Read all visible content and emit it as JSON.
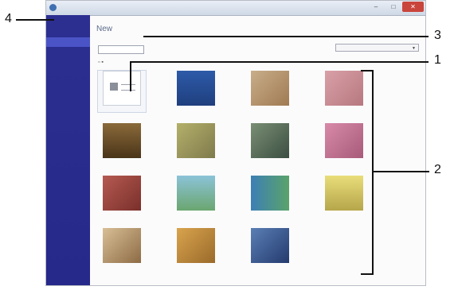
{
  "window": {
    "title": "",
    "controls": {
      "minimize": "–",
      "maximize": "□",
      "close": "✕"
    }
  },
  "sidebar": {
    "top_item": "",
    "items": [
      {
        "label": "",
        "active": true
      },
      {
        "label": "",
        "active": false
      }
    ]
  },
  "main": {
    "title": "New",
    "templates_button": "",
    "filter_label": "",
    "filter_value": "",
    "view_toggle": "▫ ▪"
  },
  "templates": [
    {
      "label": "",
      "theme": "blank"
    },
    {
      "label": "",
      "theme": "blue-tools"
    },
    {
      "label": "",
      "theme": "brown-paper"
    },
    {
      "label": "",
      "theme": "pink-craft"
    },
    {
      "label": "",
      "theme": "wine-bottles"
    },
    {
      "label": "",
      "theme": "green-tools"
    },
    {
      "label": "",
      "theme": "gift-bow"
    },
    {
      "label": "",
      "theme": "pink-tape"
    },
    {
      "label": "",
      "theme": "red-food"
    },
    {
      "label": "",
      "theme": "beach"
    },
    {
      "label": "",
      "theme": "folders"
    },
    {
      "label": "",
      "theme": "yellow-label"
    },
    {
      "label": "",
      "theme": "kitchen"
    },
    {
      "label": "",
      "theme": "orange-tape"
    },
    {
      "label": "",
      "theme": "blue-tape"
    }
  ],
  "callouts": [
    "1",
    "2",
    "3",
    "4"
  ],
  "colors": {
    "sidebar": "#2c2f90",
    "sidebar_active": "#4b54c6",
    "close_button": "#c9453c"
  }
}
